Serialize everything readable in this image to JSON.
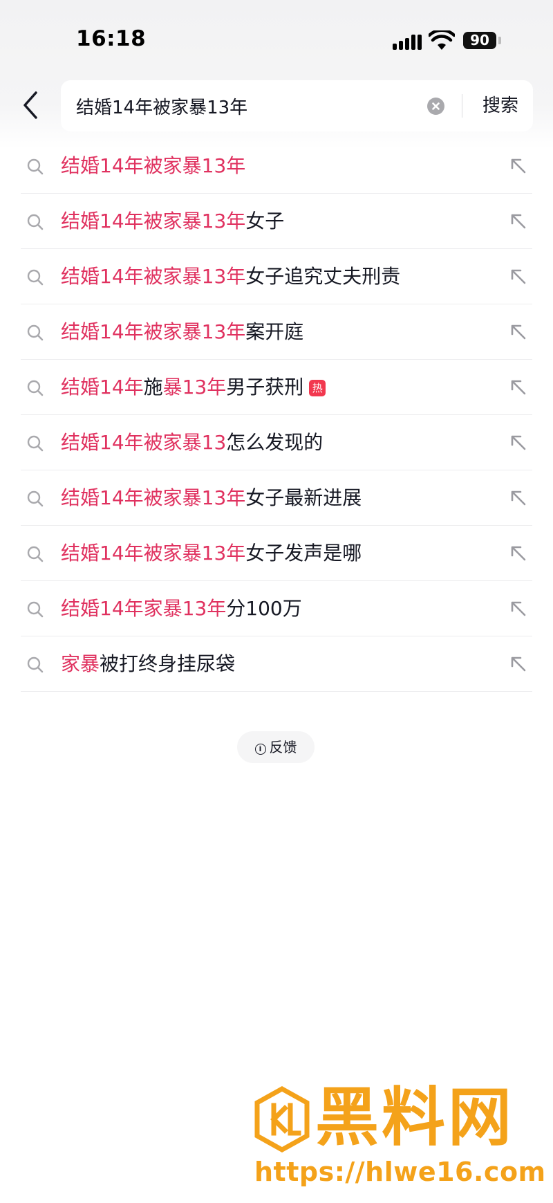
{
  "status_bar": {
    "time": "16:18",
    "battery": "90",
    "icons": [
      "signal-icon",
      "wifi-icon",
      "battery-icon"
    ]
  },
  "header": {
    "back_icon": "chevron-left-icon",
    "search": {
      "value": "结婚14年被家暴13年",
      "clear_icon": "clear-circle-icon",
      "button_label": "搜索"
    }
  },
  "suggestions": [
    {
      "highlight": "结婚14年被家暴13年",
      "rest": "",
      "badge": ""
    },
    {
      "highlight": "结婚14年被家暴13年",
      "rest": "女子",
      "badge": ""
    },
    {
      "highlight": "结婚14年被家暴13年",
      "rest": "女子追究丈夫刑责",
      "badge": ""
    },
    {
      "highlight": "结婚14年被家暴13年",
      "rest": "案开庭",
      "badge": ""
    },
    {
      "highlight": "结婚14年",
      "rest": "施",
      "highlight2": "暴13年",
      "rest2": "男子获刑",
      "badge": "热"
    },
    {
      "highlight": "结婚14年被家暴13",
      "rest": "怎么发现的",
      "badge": ""
    },
    {
      "highlight": "结婚14年被家暴13年",
      "rest": "女子最新进展",
      "badge": ""
    },
    {
      "highlight": "结婚14年被家暴13年",
      "rest": "女子发声是哪",
      "badge": ""
    },
    {
      "highlight": "结婚14年家暴13年",
      "rest": "分100万",
      "badge": ""
    },
    {
      "highlight": "家暴",
      "rest": "被打终身挂尿袋",
      "badge": ""
    }
  ],
  "suggestion_icons": {
    "left": "search-icon",
    "right": "fill-arrow-icon"
  },
  "feedback": {
    "label": "反馈",
    "icon": "info-icon"
  },
  "watermark": {
    "title": "黑料网",
    "url": "https://hlwe16.com"
  },
  "colors": {
    "highlight": "#e0315f",
    "text": "#161823",
    "hot_badge": "#f2384f",
    "watermark": "#f4a21a"
  }
}
